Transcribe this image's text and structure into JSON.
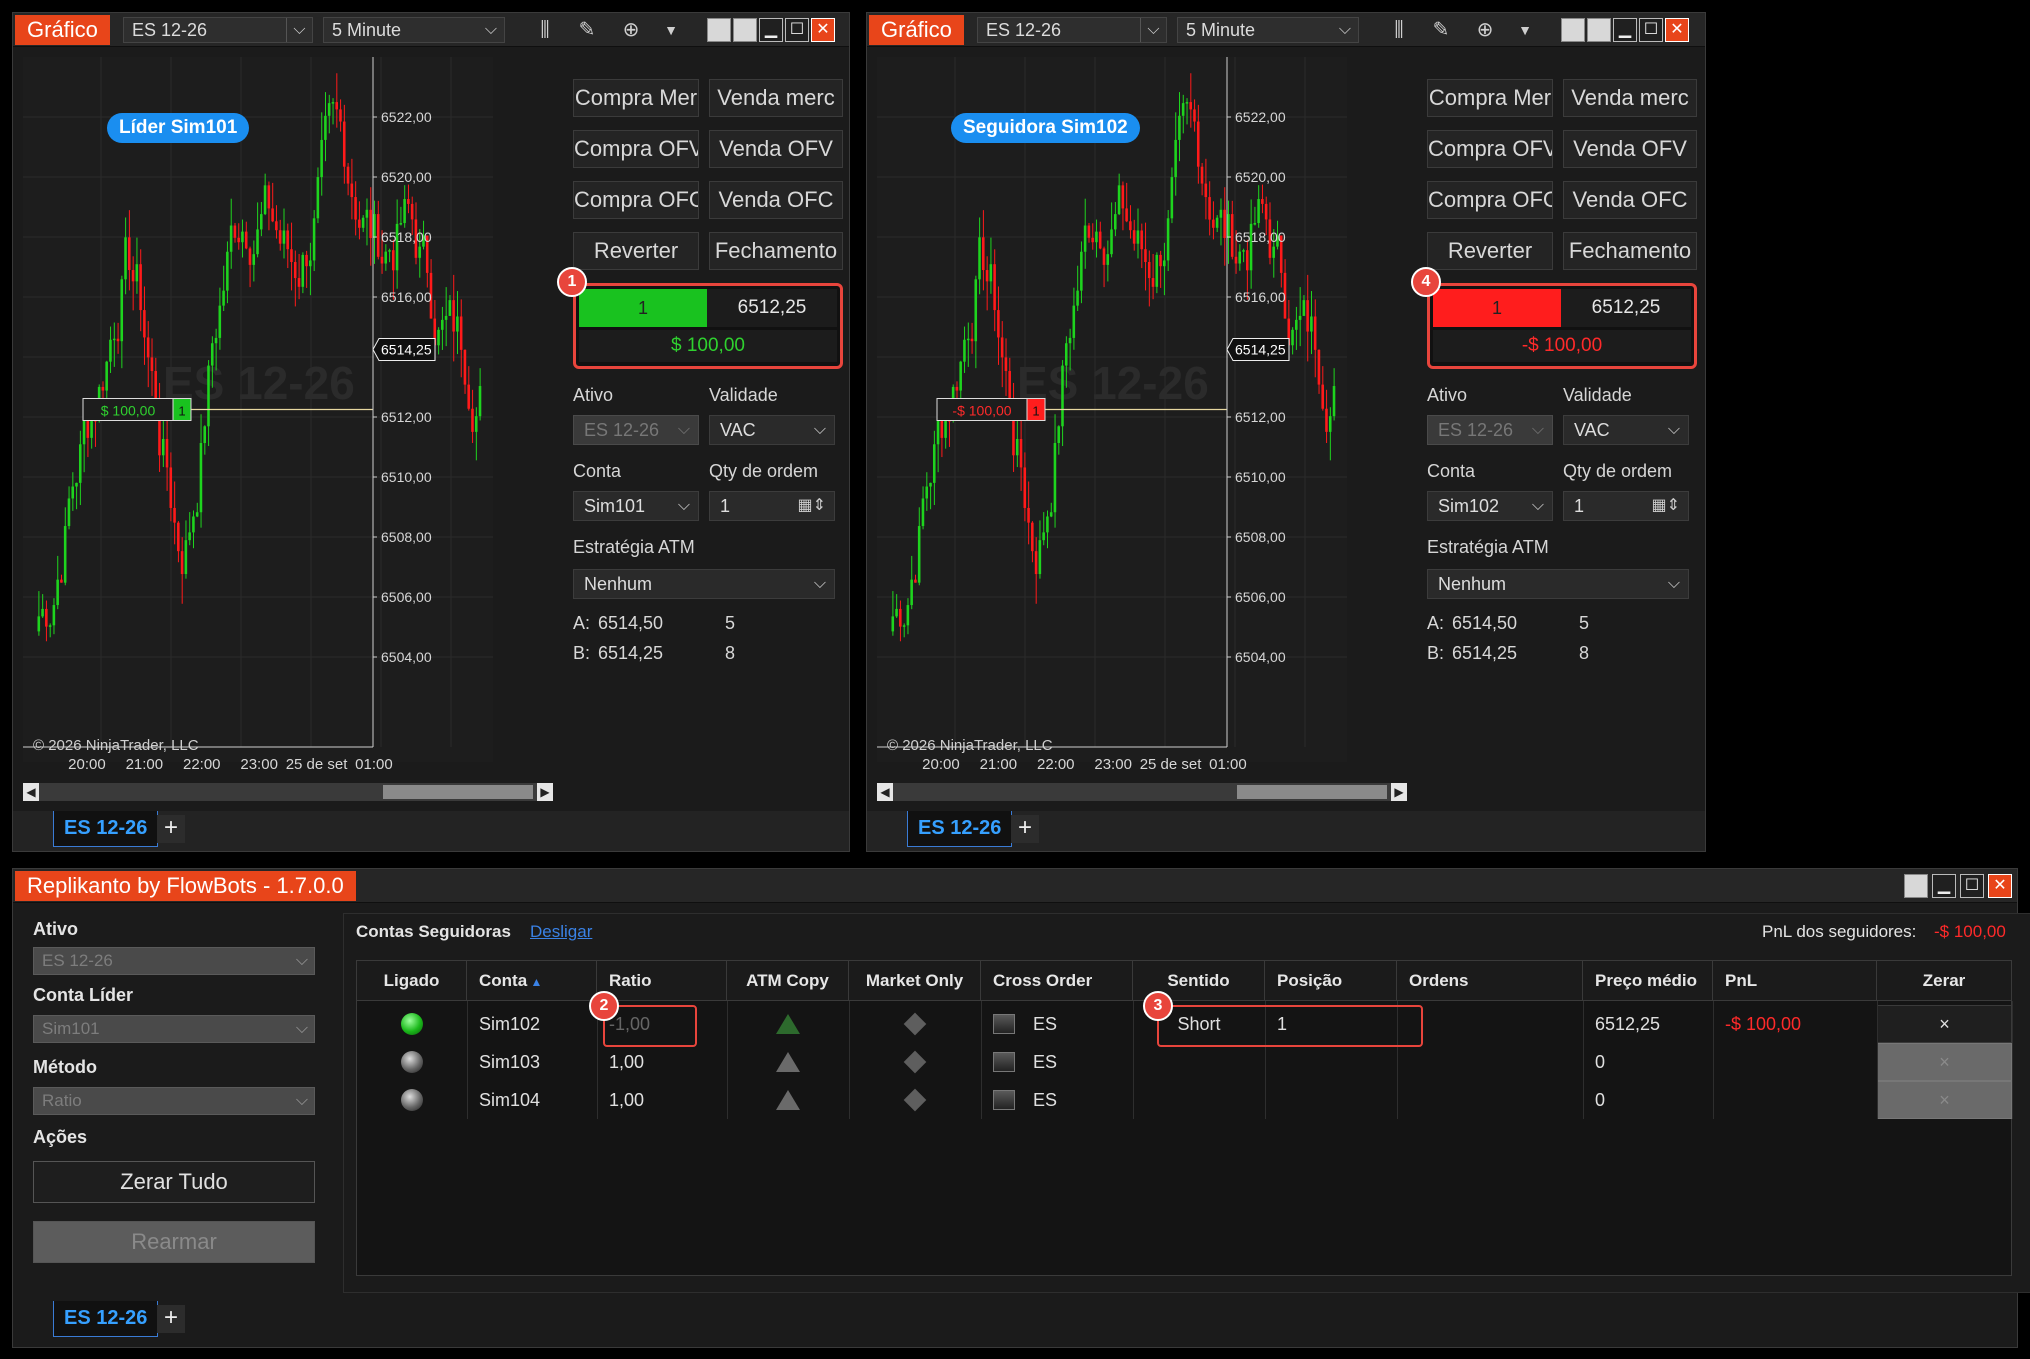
{
  "chart_windows": [
    {
      "title": "Gráfico",
      "instrument": "ES 12-26",
      "timeframe": "5 Minute",
      "pill": "Líder Sim101",
      "watermark": "ES 12-26",
      "price_labels": [
        "6522,00",
        "6520,00",
        "6518,00",
        "6516,00",
        "6514,25",
        "6512,00",
        "6510,00",
        "6508,00",
        "6506,00",
        "6504,00"
      ],
      "last_price": "6514,25",
      "time_labels": [
        "20:00",
        "21:00",
        "22:00",
        "23:00",
        "25 de set",
        "01:00"
      ],
      "copyright": "© 2026 NinjaTrader, LLC",
      "position_marker_pnl": "$ 100,00",
      "position_marker_qty": "1",
      "buttons": [
        "Compra Mer",
        "Venda merc",
        "Compra OFV",
        "Venda OFV",
        "Compra OFC",
        "Venda OFC",
        "Reverter",
        "Fechamento"
      ],
      "position": {
        "qty": "1",
        "price": "6512,25",
        "pnl": "$ 100,00",
        "side_color": "#19c21f",
        "pnl_color": "#2fd12f"
      },
      "badge": "1",
      "fields": {
        "ativo_label": "Ativo",
        "ativo_value": "ES 12-26",
        "validade_label": "Validade",
        "validade_value": "VAC",
        "conta_label": "Conta",
        "conta_value": "Sim101",
        "qty_label": "Qty de ordem",
        "qty_value": "1",
        "atm_label": "Estratégia ATM",
        "atm_value": "Nenhum"
      },
      "ask": {
        "label": "A:",
        "price": "6514,50",
        "size": "5"
      },
      "bid": {
        "label": "B:",
        "price": "6514,25",
        "size": "8"
      },
      "tab": "ES 12-26",
      "plus": "+"
    },
    {
      "title": "Gráfico",
      "instrument": "ES 12-26",
      "timeframe": "5 Minute",
      "pill": "Seguidora Sim102",
      "watermark": "ES 12-26",
      "price_labels": [
        "6522,00",
        "6520,00",
        "6518,00",
        "6516,00",
        "6514,25",
        "6512,00",
        "6510,00",
        "6508,00",
        "6506,00",
        "6504,00"
      ],
      "last_price": "6514,25",
      "time_labels": [
        "20:00",
        "21:00",
        "22:00",
        "23:00",
        "25 de set",
        "01:00"
      ],
      "copyright": "© 2026 NinjaTrader, LLC",
      "position_marker_pnl": "-$ 100,00",
      "position_marker_qty": "1",
      "buttons": [
        "Compra Mer",
        "Venda merc",
        "Compra OFV",
        "Venda OFV",
        "Compra OFC",
        "Venda OFC",
        "Reverter",
        "Fechamento"
      ],
      "position": {
        "qty": "1",
        "price": "6512,25",
        "pnl": "-$ 100,00",
        "side_color": "#ff1d1d",
        "pnl_color": "#ff2a2a"
      },
      "badge": "4",
      "fields": {
        "ativo_label": "Ativo",
        "ativo_value": "ES 12-26",
        "validade_label": "Validade",
        "validade_value": "VAC",
        "conta_label": "Conta",
        "conta_value": "Sim102",
        "qty_label": "Qty de ordem",
        "qty_value": "1",
        "atm_label": "Estratégia ATM",
        "atm_value": "Nenhum"
      },
      "ask": {
        "label": "A:",
        "price": "6514,50",
        "size": "5"
      },
      "bid": {
        "label": "B:",
        "price": "6514,25",
        "size": "8"
      },
      "tab": "ES 12-26",
      "plus": "+"
    }
  ],
  "replikanto": {
    "title": "Replikanto by FlowBots - 1.7.0.0",
    "side": {
      "ativo_label": "Ativo",
      "ativo_value": "ES 12-26",
      "lider_label": "Conta Líder",
      "lider_value": "Sim101",
      "metodo_label": "Método",
      "metodo_value": "Ratio",
      "acoes_label": "Ações",
      "zerar_tudo": "Zerar Tudo",
      "rearmar": "Rearmar"
    },
    "contas_label": "Contas Seguidoras",
    "desligar": "Desligar",
    "pnl_label": "PnL dos seguidores:",
    "pnl_value": "-$ 100,00",
    "columns": [
      "Ligado",
      "Conta",
      "Ratio",
      "ATM Copy",
      "Market Only",
      "Cross Order",
      "Sentido",
      "Posição",
      "Ordens",
      "Preço médio",
      "PnL",
      "Zerar"
    ],
    "rows": [
      {
        "conta": "Sim102",
        "ratio": "-1,00",
        "cross": "ES",
        "sentido": "Short",
        "posicao": "1",
        "ordens": "",
        "preco": "6512,25",
        "pnl": "-$ 100,00",
        "zerar": "×"
      },
      {
        "conta": "Sim103",
        "ratio": "1,00",
        "cross": "ES",
        "sentido": "",
        "posicao": "",
        "ordens": "",
        "preco": "0",
        "pnl": "",
        "zerar": "×"
      },
      {
        "conta": "Sim104",
        "ratio": "1,00",
        "cross": "ES",
        "sentido": "",
        "posicao": "",
        "ordens": "",
        "preco": "0",
        "pnl": "",
        "zerar": "×"
      }
    ],
    "badges": [
      "2",
      "3"
    ],
    "tab": "ES 12-26",
    "plus": "+"
  }
}
